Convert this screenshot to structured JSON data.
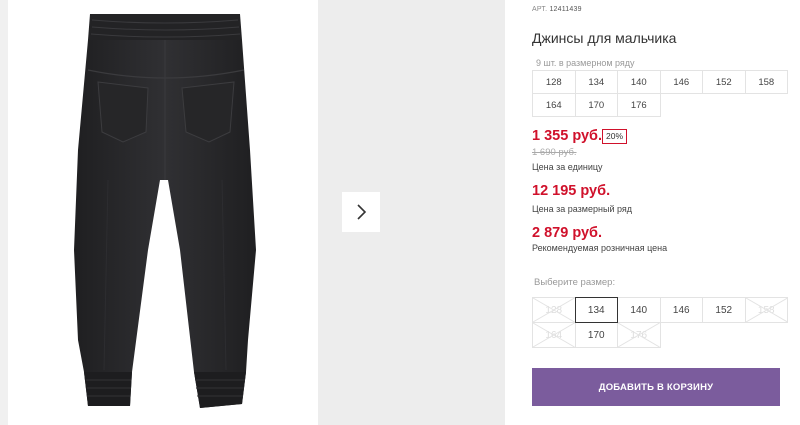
{
  "product": {
    "art_label": "АРТ.",
    "art_value": "12411439",
    "title": "Джинсы для мальчика",
    "row_count": "9 шт. в размерном ряду",
    "row_sizes": [
      "128",
      "134",
      "140",
      "146",
      "152",
      "158",
      "164",
      "170",
      "176"
    ]
  },
  "prices": {
    "unit_price": "1 355 руб.",
    "discount_badge": "20%",
    "old_price": "1 690 руб.",
    "unit_label": "Цена за единицу",
    "row_price": "12 195 руб.",
    "row_label": "Цена за размерный ряд",
    "retail_price": "2 879 руб.",
    "retail_label": "Рекомендуемая розничная цена"
  },
  "size_selector": {
    "label": "Выберите размер:",
    "options": [
      {
        "size": "128",
        "state": "disabled"
      },
      {
        "size": "134",
        "state": "selected"
      },
      {
        "size": "140",
        "state": "available"
      },
      {
        "size": "146",
        "state": "available"
      },
      {
        "size": "152",
        "state": "available"
      },
      {
        "size": "158",
        "state": "disabled"
      },
      {
        "size": "164",
        "state": "disabled"
      },
      {
        "size": "170",
        "state": "available"
      },
      {
        "size": "176",
        "state": "disabled"
      }
    ]
  },
  "actions": {
    "add_to_cart": "ДОБАВИТЬ В КОРЗИНУ"
  },
  "gallery": {
    "next_icon": "chevron-right-icon",
    "product_image": "jeans-back-view"
  },
  "colors": {
    "price_red": "#d0112b",
    "button_purple": "#7b5c9d",
    "jeans_dark": "#2b2b2d"
  }
}
